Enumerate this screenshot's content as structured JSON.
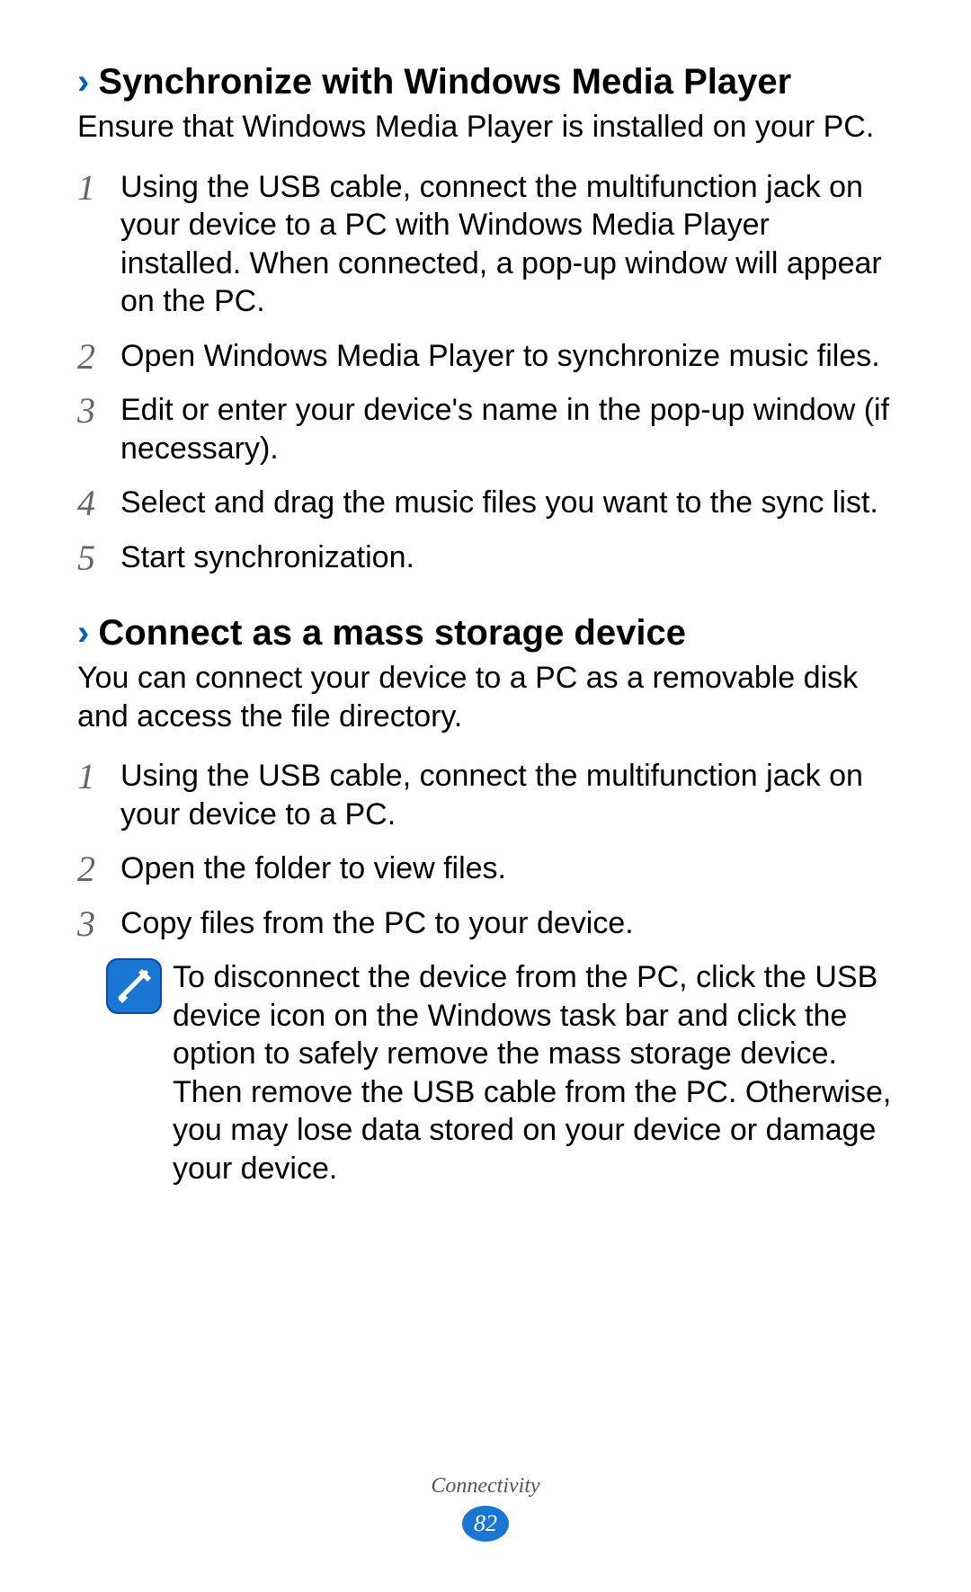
{
  "section1": {
    "heading": "Synchronize with Windows Media Player",
    "intro": "Ensure that Windows Media Player is installed on your PC.",
    "steps": [
      {
        "n": "1",
        "text": "Using the USB cable, connect the multifunction jack on your device to a PC with Windows Media Player installed. When connected, a pop-up window will appear on the PC."
      },
      {
        "n": "2",
        "text": "Open Windows Media Player to synchronize music files."
      },
      {
        "n": "3",
        "text": "Edit or enter your device's name in the pop-up window (if necessary)."
      },
      {
        "n": "4",
        "text": "Select and drag the music files you want to the sync list."
      },
      {
        "n": "5",
        "text": "Start synchronization."
      }
    ]
  },
  "section2": {
    "heading": "Connect as a mass storage device",
    "intro": "You can connect your device to a PC as a removable disk and access the file directory.",
    "steps": [
      {
        "n": "1",
        "text": "Using the USB cable, connect the multifunction jack on your device to a PC."
      },
      {
        "n": "2",
        "text": "Open the folder to view files."
      },
      {
        "n": "3",
        "text": "Copy files from the PC to your device."
      }
    ],
    "note": "To disconnect the device from the PC, click the USB device icon on the Windows task bar and click the option to safely remove the mass storage device. Then remove the USB cable from the PC. Otherwise, you may lose data stored on your device or damage your device."
  },
  "footer": {
    "label": "Connectivity",
    "page": "82"
  }
}
